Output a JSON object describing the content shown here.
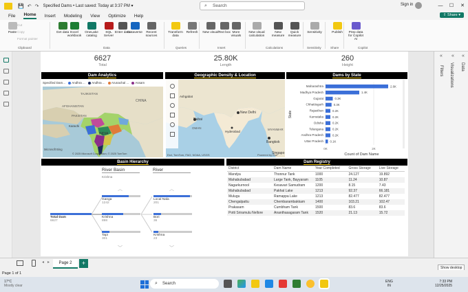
{
  "title": {
    "file": "Specified Dams",
    "saved": "Last saved: Today at 3:37 PM",
    "search_placeholder": "Search",
    "sign_in": "Sign in",
    "share": "Share"
  },
  "menu": [
    "File",
    "Home",
    "Insert",
    "Modeling",
    "View",
    "Optimize",
    "Help"
  ],
  "menu_active": "Home",
  "ribbon": {
    "buttons": [
      {
        "label": "Paste",
        "x": 6
      },
      {
        "label": "Get data",
        "x": 79
      },
      {
        "label": "Excel workbook",
        "x": 96
      },
      {
        "label": "OneLake catalog",
        "x": 121
      },
      {
        "label": "SQL Server",
        "x": 146
      },
      {
        "label": "Enter data",
        "x": 166
      },
      {
        "label": "Dataverse",
        "x": 184
      },
      {
        "label": "Recent sources",
        "x": 208
      },
      {
        "label": "Transform data",
        "x": 243
      },
      {
        "label": "Refresh",
        "x": 267
      },
      {
        "label": "New visual",
        "x": 294
      },
      {
        "label": "Text box",
        "x": 314
      },
      {
        "label": "More visuals",
        "x": 331
      },
      {
        "label": "New visual calculation",
        "x": 361
      },
      {
        "label": "New measure",
        "x": 392
      },
      {
        "label": "Quick measure",
        "x": 416
      },
      {
        "label": "Sensitivity",
        "x": 445
      },
      {
        "label": "Publish",
        "x": 478
      },
      {
        "label": "Prep data for Copilot AI",
        "x": 505
      }
    ],
    "clipboard_small": [
      "Cut",
      "Copy",
      "Format painter"
    ],
    "groups": [
      "Clipboard",
      "Data",
      "Queries",
      "Insert",
      "Calculations",
      "Sensitivity",
      "Share",
      "Copilot"
    ]
  },
  "kpis": [
    {
      "value": "6627",
      "label": "Total"
    },
    {
      "value": "25.80K",
      "label": "Length"
    },
    {
      "value": "260",
      "label": "Height"
    }
  ],
  "headers": {
    "dam_analytics": "Dam Analytics",
    "geo": "Geographic Density & Location",
    "dams_by_state": "Dams by State",
    "basin": "Basin Hierarchy",
    "registry": "Dam Registry"
  },
  "legend": {
    "title": "Specified Dam...",
    "items": [
      {
        "name": "Andhra ...",
        "color": "#3b6fd8"
      },
      {
        "name": "Andhra ...",
        "color": "#1b2a5a"
      },
      {
        "name": "Arunachal ...",
        "color": "#e07b39"
      },
      {
        "name": "Assam",
        "color": "#8a2d8a"
      }
    ]
  },
  "map_labels": {
    "china": "CHINA",
    "india": "INDIA",
    "tajikistan": "TAJIKISTAN",
    "afghanistan": "AFGHANISTAN",
    "pakistan": "PAKISTAN",
    "karachi": "Karachi",
    "delhi": "New Delhi",
    "dubai": "Dubai",
    "oman": "OMAN",
    "bangkok": "Bangkok",
    "myanmar": "MYANMAR",
    "singapore": "Singapo",
    "credits1": "© 2025 Microsoft Corporation, © 2025 TomTom",
    "credits2": "Esri, TomTom, FAO, NOAA, USGS",
    "credits3": "Powered by Esri",
    "ashgabat": "Ashgabat",
    "hyderabad": "Hyderabad",
    "bing": "Microsoft Bing"
  },
  "chart_data": {
    "type": "bar",
    "orientation": "horizontal",
    "title": "Dams by State",
    "xlabel": "Count of Dam Name",
    "ylabel": "State",
    "categories": [
      "Maharashtra",
      "Madhya Pradesh",
      "Gujarat",
      "Chhattisgarh",
      "Rajasthan",
      "Karnataka",
      "Odisha",
      "Telangana",
      "Andhra Pradesh",
      "Uttar Pradesh"
    ],
    "values": [
      2600,
      1400,
      300,
      250,
      200,
      200,
      200,
      200,
      200,
      100
    ],
    "data_labels": [
      "2.6K",
      "1.4K",
      "0.3K",
      "0.3K",
      "0.2K",
      "0.2K",
      "0.2K",
      "0.2K",
      "0.2K",
      "0.1K"
    ],
    "xticks": [
      "0K",
      "2K"
    ],
    "xlim": [
      0,
      3000
    ],
    "color": "#3b6fd8"
  },
  "slicers": {
    "river_basin": "River Basin",
    "river": "River",
    "krishna": "Krishna"
  },
  "hierarchy": {
    "root": {
      "name": "Total Dam",
      "count": "6627"
    },
    "basins": [
      {
        "name": "Ganga",
        "count": "1242",
        "frac": 0.7
      },
      {
        "name": "Krishna",
        "count": "898",
        "frac": 0.55
      },
      {
        "name": "Tapi",
        "count": "301",
        "frac": 0.2
      }
    ],
    "rivers": [
      {
        "name": "Local Nala",
        "count": "201",
        "frac": 0.95
      },
      {
        "name": "Bori",
        "count": "36",
        "frac": 0.2
      },
      {
        "name": "Krishna",
        "count": "23",
        "frac": 0.13
      }
    ]
  },
  "registry": {
    "columns": [
      "District",
      "Dam Name",
      "Year Completed",
      "Gross Storage",
      "Live Storage"
    ],
    "rows": [
      [
        "Mandya",
        "Thonnur Tank",
        "1000",
        "24.127",
        "19.892"
      ],
      [
        "Mahabubabad",
        "Large Tank, Bayyaram",
        "1105",
        "11.24",
        "10.87"
      ],
      [
        "Nagarkurnool",
        "Kesavari Samudram",
        "1200",
        "8.15",
        "7.43"
      ],
      [
        "Mahabubabad",
        "Pakhal Lake",
        "1213",
        "92.37",
        "66.181"
      ],
      [
        "Mulugu",
        "Ramappa Lake",
        "1213",
        "82.477",
        "82.477"
      ],
      [
        "Chengalpattu",
        "Chembarambakkam",
        "1400",
        "103.21",
        "102.47"
      ],
      [
        "Prakasam",
        "Cumbham Tank",
        "1500",
        "83.6",
        "83.6"
      ],
      [
        "Potti Sriramulu Nellore",
        "Ananthasagaram Tank",
        "1520",
        "21.13",
        "15.72"
      ]
    ]
  },
  "panes": {
    "filters": "Filters",
    "visualizations": "Visualizations",
    "data": "Data"
  },
  "bottom": {
    "page": "Page 2",
    "status": "Page 1 of 1",
    "show_desktop": "Show desktop"
  },
  "taskbar": {
    "weather": "17°C",
    "weather_sub": "Mostly clear",
    "search": "Search",
    "lang": "ENG",
    "lang2": "IN",
    "time": "7:33 PM",
    "date": "12/25/2025"
  }
}
